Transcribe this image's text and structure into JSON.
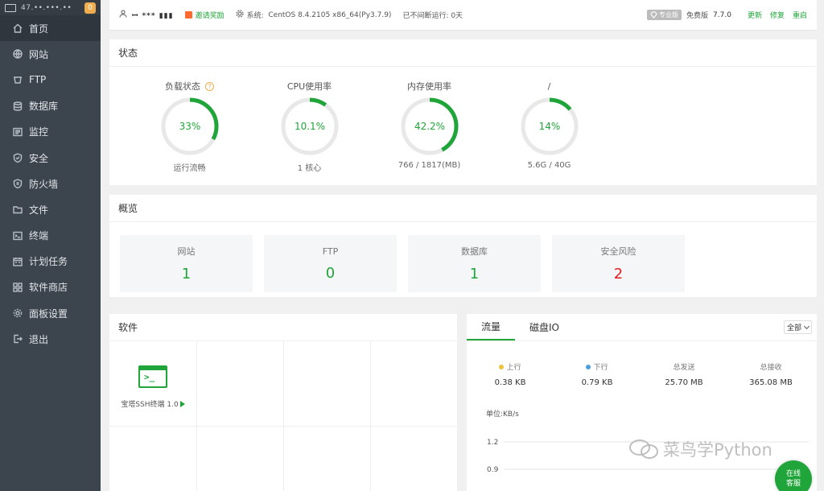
{
  "sidebar": {
    "ip": "47.••.•••.••",
    "badge": "0",
    "items": [
      {
        "label": "首页",
        "icon": "home-icon"
      },
      {
        "label": "网站",
        "icon": "globe-icon"
      },
      {
        "label": "FTP",
        "icon": "ftp-icon"
      },
      {
        "label": "数据库",
        "icon": "database-icon"
      },
      {
        "label": "监控",
        "icon": "monitor-icon"
      },
      {
        "label": "安全",
        "icon": "shield-icon"
      },
      {
        "label": "防火墙",
        "icon": "firewall-icon"
      },
      {
        "label": "文件",
        "icon": "folder-icon"
      },
      {
        "label": "终端",
        "icon": "terminal-icon"
      },
      {
        "label": "计划任务",
        "icon": "calendar-icon"
      },
      {
        "label": "软件商店",
        "icon": "grid-icon"
      },
      {
        "label": "面板设置",
        "icon": "settings-icon"
      },
      {
        "label": "退出",
        "icon": "logout-icon"
      }
    ]
  },
  "topbar": {
    "user": "ꟷ *** ▮▮▮",
    "invite": "邀请奖励",
    "system_label": "系统:",
    "system_value": "CentOS 8.4.2105 x86_64(Py3.7.9)",
    "uptime": "已不间断运行: 0天",
    "pro": "专业版",
    "edition": "免费版",
    "version": "7.7.0",
    "update": "更新",
    "repair": "修复",
    "restart": "重启"
  },
  "status": {
    "title": "状态",
    "gauges": [
      {
        "title": "负载状态",
        "value": "33%",
        "percent": 33,
        "sub": "运行流畅",
        "help": "?"
      },
      {
        "title": "CPU使用率",
        "value": "10.1%",
        "percent": 10.1,
        "sub": "1 核心"
      },
      {
        "title": "内存使用率",
        "value": "42.2%",
        "percent": 42.2,
        "sub": "766 / 1817(MB)"
      },
      {
        "title": "/",
        "value": "14%",
        "percent": 14,
        "sub": "5.6G / 40G"
      }
    ]
  },
  "overview": {
    "title": "概览",
    "cards": [
      {
        "label": "网站",
        "value": "1"
      },
      {
        "label": "FTP",
        "value": "0"
      },
      {
        "label": "数据库",
        "value": "1"
      },
      {
        "label": "安全风险",
        "value": "2"
      }
    ]
  },
  "software": {
    "title": "软件",
    "items": [
      {
        "name": "宝塔SSH终端 1.0"
      }
    ]
  },
  "traffic": {
    "tabs": [
      "流量",
      "磁盘IO"
    ],
    "select": "全部",
    "stats": [
      {
        "label": "上行",
        "value": "0.38 KB",
        "dot": "#f0c040"
      },
      {
        "label": "下行",
        "value": "0.79 KB",
        "dot": "#4a9fe0"
      },
      {
        "label": "总发送",
        "value": "25.70 MB"
      },
      {
        "label": "总接收",
        "value": "365.08 MB"
      }
    ],
    "unit": "单位:KB/s",
    "y_ticks": [
      "1.2",
      "0.9"
    ]
  },
  "watermark": "菜鸟学Python",
  "online_service": [
    "在线",
    "客服"
  ],
  "colors": {
    "accent": "#20a53a",
    "danger": "#e01e1e",
    "sidebar": "#3c444d"
  }
}
